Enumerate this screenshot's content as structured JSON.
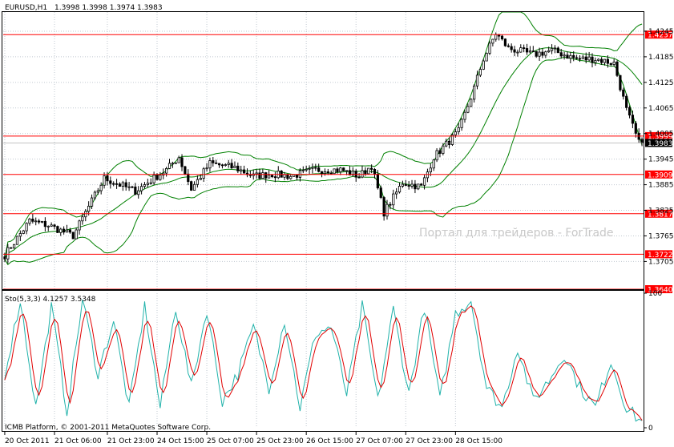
{
  "chart_data": [
    {
      "type": "candlestick",
      "header": {
        "symbol_label": "EURUSD,H1",
        "ohlc_label": "1.3998 1.3998 1.3974 1.3983"
      },
      "watermark": "Портал для трейдеров - ForTrade",
      "ylim": [
        1.364,
        1.429
      ],
      "y_ticks": [
        "1.4245",
        "1.4185",
        "1.4125",
        "1.4065",
        "1.4005",
        "1.3945",
        "1.3885",
        "1.3825",
        "1.3765",
        "1.3705"
      ],
      "y_tick_values": [
        1.4245,
        1.4185,
        1.4125,
        1.4065,
        1.4005,
        1.3945,
        1.3885,
        1.3825,
        1.3765,
        1.3705
      ],
      "current_price": "1.3983",
      "current_price_value": 1.3983,
      "level_lines": [
        {
          "label": "1.4237",
          "value": 1.4237
        },
        {
          "label": "1.3999",
          "value": 1.3999
        },
        {
          "label": "1.3909",
          "value": 1.3909
        },
        {
          "label": "1.3817",
          "value": 1.3817
        },
        {
          "label": "1.3722",
          "value": 1.3722
        },
        {
          "label": "1.3640",
          "value": 1.364
        }
      ],
      "bollinger": {
        "period": 20,
        "deviation": 2
      },
      "anchors": [
        [
          0,
          1.372
        ],
        [
          8,
          1.38
        ],
        [
          14,
          1.379
        ],
        [
          22,
          1.3765
        ],
        [
          26,
          1.382
        ],
        [
          32,
          1.39
        ],
        [
          42,
          1.387
        ],
        [
          52,
          1.392
        ],
        [
          56,
          1.395
        ],
        [
          60,
          1.3875
        ],
        [
          66,
          1.3935
        ],
        [
          74,
          1.3925
        ],
        [
          80,
          1.3905
        ],
        [
          86,
          1.391
        ],
        [
          92,
          1.3905
        ],
        [
          100,
          1.392
        ],
        [
          108,
          1.392
        ],
        [
          114,
          1.3905
        ],
        [
          118,
          1.393
        ],
        [
          122,
          1.382
        ],
        [
          128,
          1.389
        ],
        [
          134,
          1.388
        ],
        [
          138,
          1.395
        ],
        [
          146,
          1.401
        ],
        [
          150,
          1.409
        ],
        [
          154,
          1.418
        ],
        [
          158,
          1.424
        ],
        [
          162,
          1.4205
        ],
        [
          170,
          1.419
        ],
        [
          176,
          1.42
        ],
        [
          184,
          1.418
        ],
        [
          190,
          1.418
        ],
        [
          196,
          1.417
        ],
        [
          200,
          1.406
        ],
        [
          204,
          1.3983
        ]
      ]
    },
    {
      "type": "line",
      "indicator": "Stochastic",
      "label": "Sto(5,3,3) 4.1257 3.5348",
      "ylim": [
        0,
        100
      ],
      "y_ticks": [
        "100",
        "0"
      ],
      "y_tick_values": [
        100,
        0
      ],
      "series": [
        {
          "color": "#20b2aa"
        },
        {
          "color": "#e00000"
        }
      ],
      "peaks": [
        [
          0,
          40
        ],
        [
          5,
          95
        ],
        [
          10,
          15
        ],
        [
          15,
          90
        ],
        [
          20,
          12
        ],
        [
          25,
          95
        ],
        [
          30,
          40
        ],
        [
          35,
          80
        ],
        [
          40,
          15
        ],
        [
          45,
          90
        ],
        [
          50,
          15
        ],
        [
          55,
          90
        ],
        [
          60,
          30
        ],
        [
          65,
          88
        ],
        [
          70,
          20
        ],
        [
          75,
          40
        ],
        [
          80,
          75
        ],
        [
          85,
          30
        ],
        [
          90,
          80
        ],
        [
          95,
          15
        ],
        [
          100,
          70
        ],
        [
          105,
          75
        ],
        [
          110,
          25
        ],
        [
          115,
          90
        ],
        [
          120,
          20
        ],
        [
          125,
          88
        ],
        [
          130,
          25
        ],
        [
          135,
          90
        ],
        [
          140,
          20
        ],
        [
          145,
          85
        ],
        [
          150,
          95
        ],
        [
          155,
          30
        ],
        [
          160,
          15
        ],
        [
          165,
          60
        ],
        [
          170,
          20
        ],
        [
          175,
          35
        ],
        [
          180,
          55
        ],
        [
          185,
          30
        ],
        [
          190,
          15
        ],
        [
          195,
          50
        ],
        [
          200,
          15
        ],
        [
          205,
          4
        ]
      ]
    }
  ],
  "x_ticks": [
    {
      "label": "20 Oct 2011",
      "bar": 0
    },
    {
      "label": "21 Oct 06:00",
      "bar": 16
    },
    {
      "label": "21 Oct 23:00",
      "bar": 33
    },
    {
      "label": "24 Oct 15:00",
      "bar": 49
    },
    {
      "label": "25 Oct 07:00",
      "bar": 65
    },
    {
      "label": "25 Oct 23:00",
      "bar": 81
    },
    {
      "label": "26 Oct 15:00",
      "bar": 97
    },
    {
      "label": "27 Oct 07:00",
      "bar": 113
    },
    {
      "label": "27 Oct 23:00",
      "bar": 129
    },
    {
      "label": "28 Oct 15:00",
      "bar": 145
    }
  ],
  "footer": "ICMB Platform, © 2001-2011 MetaQuotes Software Corp.",
  "colors": {
    "candle": "#000000",
    "band": "#008000",
    "level_line": "#ff0000",
    "tag": "#ff0000",
    "grid": "#c0c8d0"
  }
}
